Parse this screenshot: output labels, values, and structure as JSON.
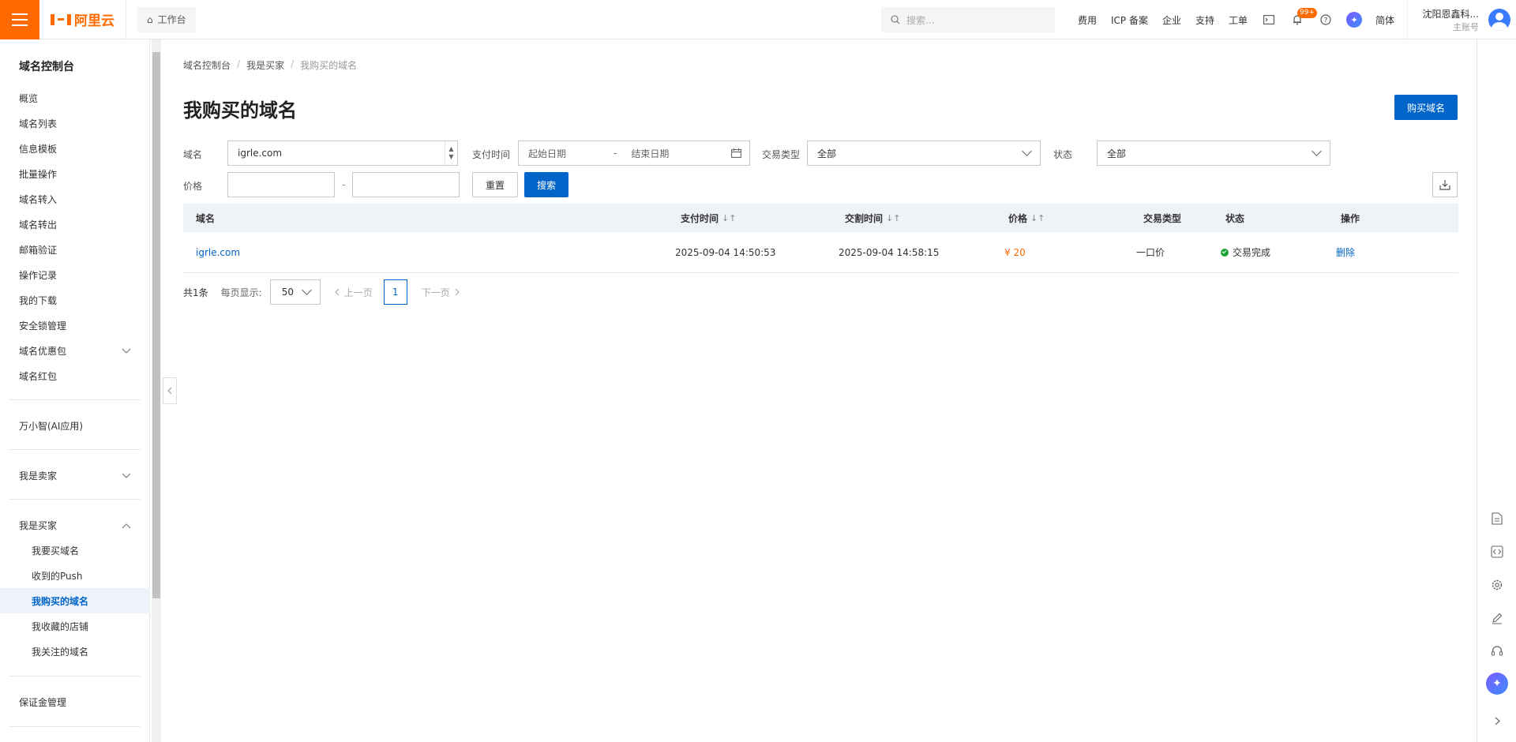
{
  "topbar": {
    "logo_text": "阿里云",
    "workbench": "工作台",
    "search_placeholder": "搜索...",
    "links": [
      "费用",
      "ICP 备案",
      "企业",
      "支持",
      "工单"
    ],
    "notify_badge": "99+",
    "lang": "简体",
    "account_name": "沈阳恩鑫科...",
    "account_role": "主账号"
  },
  "sidebar": {
    "title": "域名控制台",
    "items": [
      "概览",
      "域名列表",
      "信息模板",
      "批量操作",
      "域名转入",
      "域名转出",
      "邮箱验证",
      "操作记录",
      "我的下载",
      "安全锁管理",
      "域名优惠包",
      "域名红包"
    ],
    "ai_app": "万小智(AI应用)",
    "seller": "我是卖家",
    "buyer": "我是买家",
    "buyer_subs": [
      "我要买域名",
      "收到的Push",
      "我购买的域名",
      "我收藏的店铺",
      "我关注的域名"
    ],
    "deposit": "保证金管理"
  },
  "breadcrumb": [
    "域名控制台",
    "我是买家",
    "我购买的域名"
  ],
  "page": {
    "title": "我购买的域名",
    "buy_button": "购买域名"
  },
  "filters": {
    "domain_label": "域名",
    "domain_value": "igrle.com",
    "paytime_label": "支付时间",
    "start_placeholder": "起始日期",
    "range_sep": "-",
    "end_placeholder": "结束日期",
    "trade_type_label": "交易类型",
    "trade_type_value": "全部",
    "status_label": "状态",
    "status_value": "全部",
    "price_label": "价格",
    "price_sep": "-",
    "reset": "重置",
    "search": "搜索"
  },
  "table": {
    "headers": [
      "域名",
      "支付时间",
      "交割时间",
      "价格",
      "交易类型",
      "状态",
      "操作"
    ],
    "rows": [
      {
        "domain": "igrle.com",
        "pay_time": "2025-09-04 14:50:53",
        "deliver_time": "2025-09-04 14:58:15",
        "price": "¥ 20",
        "trade_type": "一口价",
        "status": "交易完成",
        "action": "删除"
      }
    ]
  },
  "pager": {
    "total": "共1条",
    "per_page_label": "每页显示:",
    "per_page": "50",
    "prev": "上一页",
    "current": "1",
    "next": "下一页"
  },
  "colors": {
    "accent": "#0064c8",
    "brand": "#ff6a00",
    "success": "#1ca336"
  }
}
